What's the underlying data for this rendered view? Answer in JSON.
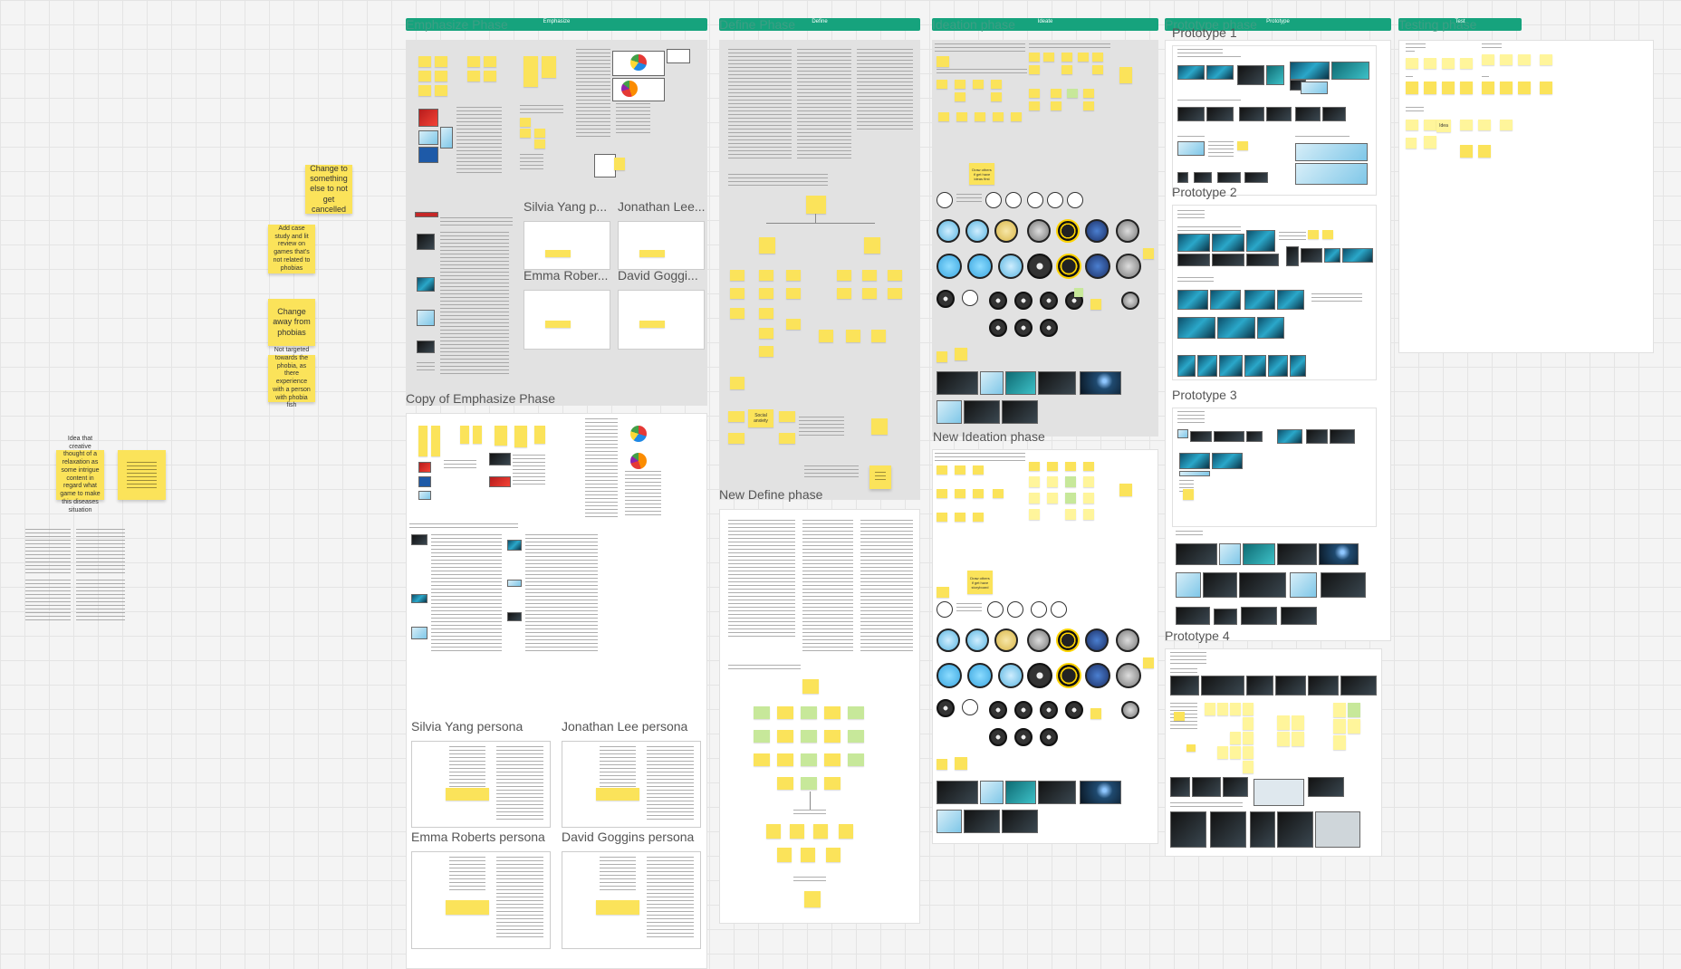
{
  "phase_bars": {
    "emphasize": {
      "title": "Emphasize Phase",
      "label": "Emphasize"
    },
    "define": {
      "title": "Define Phase",
      "label": "Define"
    },
    "ideation": {
      "title": "Ideation phase",
      "label": "Ideate"
    },
    "prototype": {
      "title": "Prototype phase",
      "label": "Prototype"
    },
    "testing": {
      "title": "Testing phase",
      "label": "Test"
    }
  },
  "frames": {
    "copy_emphasize": "Copy of Emphasize Phase",
    "new_define": "New Define phase",
    "new_ideation": "New Ideation phase",
    "prototype_1": "Prototype 1",
    "prototype_2": "Prototype 2",
    "prototype_3": "Prototype 3",
    "prototype_4": "Prototype 4"
  },
  "persona_short": {
    "silvia": "Silvia Yang p...",
    "jonathan": "Jonathan Lee...",
    "emma": "Emma Rober...",
    "david": "David Goggi..."
  },
  "persona_full": {
    "silvia": "Silvia Yang persona",
    "jonathan": "Jonathan Lee persona",
    "emma": "Emma Roberts persona",
    "david": "David Goggins persona"
  },
  "stickies": {
    "s1": "Change to something else to not get cancelled",
    "s2": "Add case study and lit review on games that's not related to phobias",
    "s3": "Change away from phobias",
    "s4": "Not targeted towards the phobia, as there experience with a person with phobia fish",
    "s5": "Idea that creative thought of a relaxation as some intrigue content in regard what game to make this diseases situation"
  },
  "define_notes": {
    "social_anxiety": "Social anxiety"
  },
  "ideation_notes": {
    "draw": "Draw others if get have ideas first",
    "draw2": "Draw others if get have storyboard"
  },
  "testing_notes": {
    "idea": "Idea"
  },
  "colors": {
    "phase_bar": "#16a37d",
    "sticky": "#fbe35a",
    "canvas": "#f4f4f4"
  }
}
